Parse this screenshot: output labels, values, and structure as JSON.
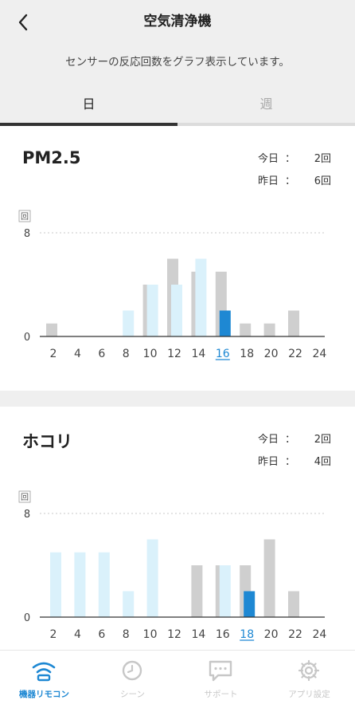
{
  "header": {
    "title": "空気清浄機",
    "subtitle": "センサーの反応回数をグラフ表示しています。",
    "back_icon": "chevron-left-icon"
  },
  "tabs": [
    {
      "label": "日",
      "active": true
    },
    {
      "label": "週",
      "active": false
    }
  ],
  "cards": [
    {
      "title": "PM2.5",
      "today_label": "今日",
      "today_value": "2回",
      "yesterday_label": "昨日",
      "yesterday_value": "6回"
    },
    {
      "title": "ホコリ",
      "today_label": "今日",
      "today_value": "2回",
      "yesterday_label": "昨日",
      "yesterday_value": "4回"
    }
  ],
  "colon": "：",
  "chart_data": [
    {
      "type": "bar",
      "unit_label": "回",
      "yticks": [
        "0",
        "8"
      ],
      "ylim": [
        0,
        8
      ],
      "categories": [
        "2",
        "4",
        "6",
        "8",
        "10",
        "12",
        "14",
        "16",
        "18",
        "20",
        "22",
        "24"
      ],
      "highlight_category": "16",
      "series": [
        {
          "values": [
            1,
            0,
            0,
            0,
            4,
            6,
            5,
            5,
            1,
            1,
            2,
            0
          ]
        },
        {
          "values": [
            0,
            0,
            0,
            2,
            4,
            4,
            6,
            2,
            0,
            0,
            0,
            0
          ]
        }
      ],
      "current_hour_value": 2
    },
    {
      "type": "bar",
      "unit_label": "回",
      "yticks": [
        "0",
        "8"
      ],
      "ylim": [
        0,
        8
      ],
      "categories": [
        "2",
        "4",
        "6",
        "8",
        "10",
        "12",
        "14",
        "16",
        "18",
        "20",
        "22",
        "24"
      ],
      "highlight_category": "18",
      "series": [
        {
          "values": [
            0,
            0,
            0,
            0,
            0,
            0,
            4,
            4,
            4,
            6,
            2,
            0
          ]
        },
        {
          "values": [
            5,
            5,
            5,
            2,
            6,
            0,
            0,
            4,
            2,
            0,
            0,
            0
          ]
        }
      ],
      "current_hour_value": 2
    }
  ],
  "colors": {
    "grey_bar": "#cfcfcf",
    "light_bar": "#daf1fb",
    "current_bar": "#1e88d3",
    "accent": "#1e88d3",
    "nav_inactive": "#c7c7c7"
  },
  "nav": [
    {
      "label": "機器リモコン",
      "icon": "wifi-icon",
      "active": true
    },
    {
      "label": "シーン",
      "icon": "clock-icon",
      "active": false
    },
    {
      "label": "サポート",
      "icon": "chat-icon",
      "active": false
    },
    {
      "label": "アプリ設定",
      "icon": "gear-icon",
      "active": false
    }
  ]
}
